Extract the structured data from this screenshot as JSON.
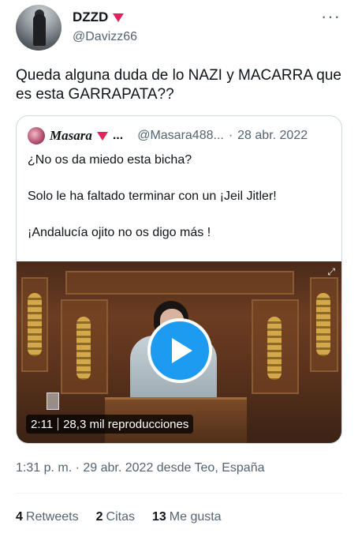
{
  "author": {
    "display_name": "DZZD",
    "handle": "@Davizz66"
  },
  "tweet": {
    "text": "Queda alguna duda de lo NAZI y MACARRA que es esta GARRAPATA??"
  },
  "quoted_tweet": {
    "display_name": "Masara",
    "name_overflow": "...",
    "handle": "@Masara488...",
    "separator": "·",
    "date": "28 abr. 2022",
    "paragraphs": [
      "¿No os da miedo esta bicha?",
      "Solo le ha faltado terminar con un ¡Jeil Jitler!",
      "¡Andalucía ojito no os digo más !"
    ],
    "video": {
      "duration": "2:11",
      "views": "28,3 mil reproducciones"
    }
  },
  "timestamp": "1:31 p. m. · 29 abr. 2022 desde Teo, España",
  "stats": {
    "retweets_count": "4",
    "retweets_label": "Retweets",
    "quotes_count": "2",
    "quotes_label": "Citas",
    "likes_count": "13",
    "likes_label": "Me gusta"
  },
  "colors": {
    "accent": "#1d9bf0",
    "flag": "#e0245e",
    "secondary_text": "#536471"
  },
  "icons": {
    "more": "more-horizontal-icon",
    "play": "play-icon",
    "flag": "red-triangle-icon"
  }
}
